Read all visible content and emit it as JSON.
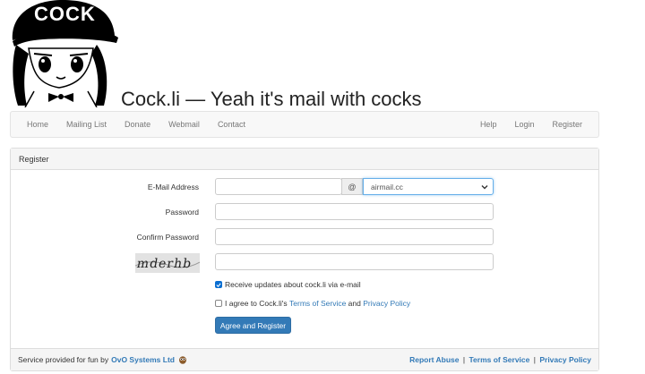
{
  "header": {
    "logo_text": "COCK",
    "title": "Cock.li — Yeah it's mail with cocks"
  },
  "nav": {
    "left": [
      "Home",
      "Mailing List",
      "Donate",
      "Webmail",
      "Contact"
    ],
    "right": [
      "Help",
      "Login",
      "Register"
    ]
  },
  "panel": {
    "heading": "Register",
    "email_label": "E-Mail Address",
    "email_value": "",
    "at_symbol": "@",
    "domain_selected": "airmail.cc",
    "password_label": "Password",
    "confirm_label": "Confirm Password",
    "captcha_text": "mderhb",
    "updates_label": "Receive updates about cock.li via e-mail",
    "updates_checked": true,
    "agree_prefix": "I agree to Cock.li's ",
    "agree_tos": "Terms of Service",
    "agree_and": " and ",
    "agree_privacy": "Privacy Policy",
    "agree_checked": false,
    "submit_label": "Agree and Register"
  },
  "footer": {
    "provided_text": "Service provided for fun by",
    "company": "OvO Systems Ltd",
    "report_abuse": "Report Abuse",
    "sep": "|",
    "terms": "Terms of Service",
    "privacy": "Privacy Policy"
  },
  "colors": {
    "primary": "#337ab7",
    "checkbox": "#0a6ed1",
    "panel_bg": "#f5f5f5"
  }
}
